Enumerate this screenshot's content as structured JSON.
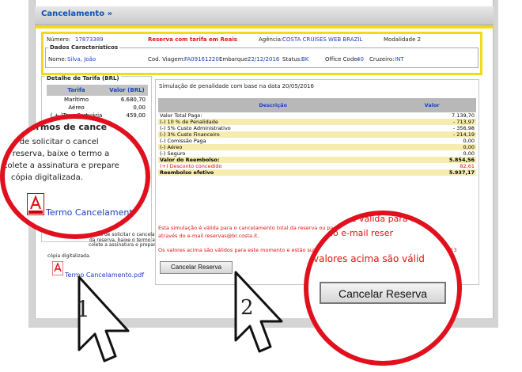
{
  "header": {
    "title": "Cancelamento",
    "chevron": "»"
  },
  "reservation": {
    "numero_label": "Número:",
    "numero_value": "17873389",
    "reserva_note": "Reserva com tarifa em Reais",
    "agencia_label": "Agência:",
    "agencia_value": "COSTA CRUISES WEB BRAZIL",
    "modalidade": "Modalidade 2"
  },
  "dados": {
    "legend": "Dados Característicos",
    "nome_label": "Nome:",
    "nome_value": "Silva, João",
    "cod_label": "Cod. Viagem:",
    "cod_value": "FA09161220",
    "embarque_label": "Embarque:",
    "embarque_value": "22/12/2016",
    "status_label": "Status:",
    "status_value": "BK",
    "office_label": "Office Code:",
    "office_value": "40",
    "cruzeiro_label": "Cruzeiro:",
    "cruzeiro_value": "INT"
  },
  "tarifa": {
    "legend": "Detalhe de Tarifa (BRL)",
    "col1": "Tarifa",
    "col2": "Valor (BRL)",
    "rows": [
      {
        "label": "Marítimo",
        "value": "6.680,70"
      },
      {
        "label": "Aéreo",
        "value": "0,00"
      },
      {
        "label": "( + )Taxa Portuária",
        "value": "459,00"
      }
    ],
    "pdf_note_1": "Antes de solicitar o cancelamento",
    "pdf_note_2": "da reserva, baixe o termo abaixo,",
    "pdf_note_3": "colete a assinatura e prepare uma",
    "pdf_note_4": "cópia digitalizada.",
    "pdf_link": "Termo Cancelamento.pdf"
  },
  "simulacao": {
    "title": "Simulação de penalidade com base na data 20/05/2016",
    "col_desc": "Descrição",
    "col_valor": "Valor",
    "rows": [
      {
        "desc": "Valor Total Pago:",
        "valor": "7.139,70",
        "style": "w"
      },
      {
        "desc": "(-) 10 % de Penalidade",
        "valor": "- 713,97",
        "style": "y"
      },
      {
        "desc": "(-) 5% Custo Administrativo",
        "valor": "- 356,98",
        "style": "w"
      },
      {
        "desc": "(-) 3% Custo Financeiro",
        "valor": "- 214,19",
        "style": "y"
      },
      {
        "desc": "(-) Comissão Paga",
        "valor": "0,00",
        "style": "w"
      },
      {
        "desc": "(-) Aéreo",
        "valor": "0,00",
        "style": "y"
      },
      {
        "desc": "(-) Seguro",
        "valor": "0,00",
        "style": "w"
      },
      {
        "desc": "Valor do Reembolso:",
        "valor": "5.854,56",
        "style": "y"
      },
      {
        "desc": "(+) Desconto concedido",
        "valor": "82,61",
        "style": "w"
      },
      {
        "desc": "Reembolso efetivo",
        "valor": "5.937,17",
        "style": "y"
      }
    ],
    "note_1": "Esta simulação é válida para o cancelamento total da reserva ou para o cancelamento parcial contate",
    "note_2": "através do e-mail reservas@br.costa.it.",
    "note_3": "Os valores acima são válidos para este momento e estão sujeitos a alterações até 23:59:59 h do dia 20/05/2016 13",
    "cancel_button": "Cancelar Reserva"
  },
  "zoom_left": {
    "heading": "ar termos de cance",
    "line1": "ntes de solicitar o cancel",
    "line2": "da reserva, baixe o termo a",
    "line3": "colete a assinatura e prepare",
    "line4": "cópia digitalizada.",
    "link": "Termo Cancelament"
  },
  "zoom_right": {
    "line1": "ação é válida para o ca",
    "line2": "do e-mail reser",
    "line3": "valores acima são válid",
    "button": "Cancelar Reserva"
  },
  "steps": {
    "one": "1",
    "two": "2"
  },
  "colors": {
    "accent_red": "#e0101e",
    "yellow": "#f0da1c",
    "link_blue": "#1a3fc4"
  }
}
